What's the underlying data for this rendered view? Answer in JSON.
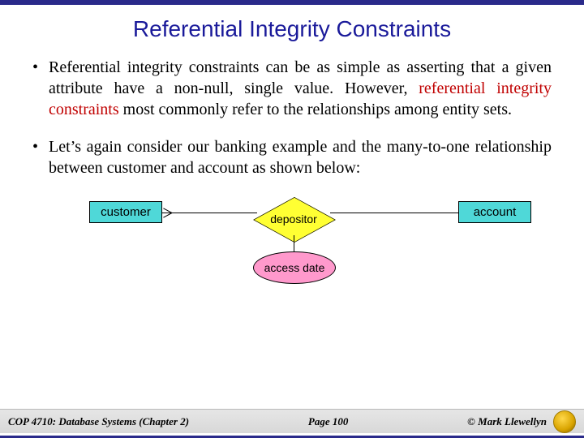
{
  "title": "Referential Integrity Constraints",
  "bullets": [
    {
      "pre": "Referential integrity constraints can be as simple as asserting that a given attribute have a non-null, single value.  However, ",
      "highlight": "referential integrity constraints",
      "post": " most commonly refer to the relationships among entity sets."
    },
    {
      "pre": "Let’s again consider our banking example and the many-to-one relationship between customer and account as shown below:",
      "highlight": "",
      "post": ""
    }
  ],
  "diagram": {
    "entity_left": "customer",
    "relationship": "depositor",
    "entity_right": "account",
    "attribute": "access date"
  },
  "footer": {
    "left": "COP 4710: Database Systems  (Chapter 2)",
    "center": "Page 100",
    "right": "© Mark Llewellyn"
  }
}
